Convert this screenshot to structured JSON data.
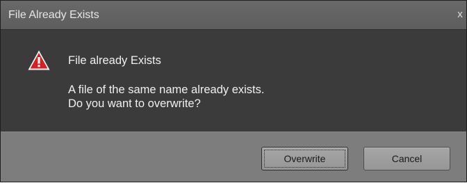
{
  "window": {
    "title": "File Already Exists",
    "close_glyph": "x"
  },
  "content": {
    "icon": "warning-triangle-icon",
    "heading": "File already Exists",
    "message_line1": "A file of the same name already exists.",
    "message_line2": "Do you want to overwrite?"
  },
  "buttons": {
    "overwrite_label": "Overwrite",
    "cancel_label": "Cancel"
  },
  "colors": {
    "dialog_body": "#3b3b3b",
    "titlebar": "#626262",
    "footer": "#7d7d7d",
    "warning_red": "#d91f26"
  }
}
